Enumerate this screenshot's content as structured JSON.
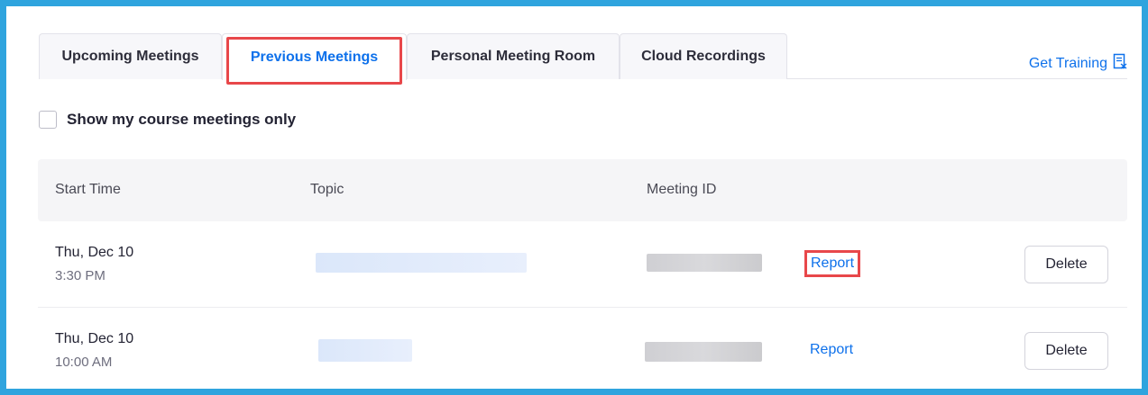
{
  "tabs": [
    {
      "label": "Upcoming Meetings",
      "active": false
    },
    {
      "label": "Previous Meetings",
      "active": true
    },
    {
      "label": "Personal Meeting Room",
      "active": false
    },
    {
      "label": "Cloud Recordings",
      "active": false
    }
  ],
  "training": {
    "label": "Get Training",
    "icon": "book-icon"
  },
  "filter": {
    "label": "Show my course meetings only",
    "checked": false
  },
  "table": {
    "headers": {
      "start_time": "Start Time",
      "topic": "Topic",
      "meeting_id": "Meeting ID"
    },
    "rows": [
      {
        "date": "Thu, Dec 10",
        "time": "3:30 PM",
        "report_label": "Report",
        "delete_label": "Delete",
        "highlighted": true
      },
      {
        "date": "Thu, Dec 10",
        "time": "10:00 AM",
        "report_label": "Report",
        "delete_label": "Delete",
        "highlighted": false
      }
    ]
  },
  "colors": {
    "accent": "#0e71eb",
    "frame": "#2fa4de",
    "highlight": "#e8474a"
  }
}
